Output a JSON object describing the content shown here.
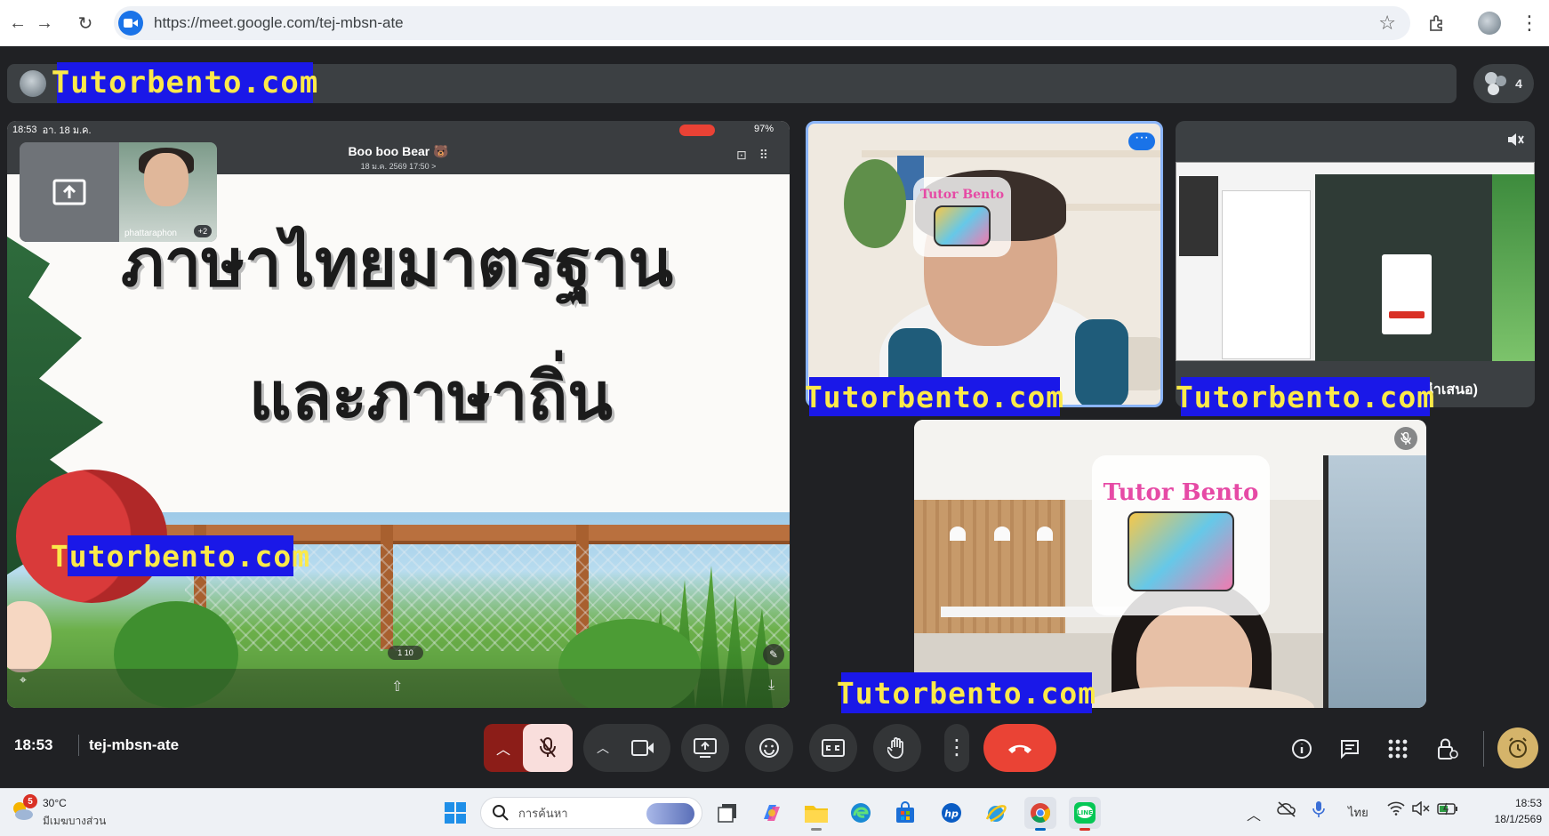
{
  "browser": {
    "url": "https://meet.google.com/tej-mbsn-ate",
    "back_glyph": "←",
    "forward_glyph": "→",
    "reload_glyph": "↻",
    "star_glyph": "☆",
    "menu_glyph": "⋮"
  },
  "watermark": "Tutorbento.com",
  "top_bar": {
    "people_count": "4"
  },
  "main_screen": {
    "status_time": "18:53",
    "status_date": "อา. 18 ม.ค.",
    "battery": "97%",
    "doc_title": "Boo boo Bear 🐻",
    "doc_subtitle": "18 ม.ค. 2569 17:50 >",
    "slide_line1": "ภาษาไทยมาตรฐาน",
    "slide_line2": "และภาษาถิ่น",
    "pager": "1 10",
    "pip_name": "phattaraphon",
    "pip_badge": "+2"
  },
  "tile1": {
    "logo_text": "Tutor Bento"
  },
  "tile2": {
    "name_suffix": "นนำเสนอ)"
  },
  "tile3": {
    "logo_text": "Tutor Bento"
  },
  "controls": {
    "time": "18:53",
    "meeting_code": "tej-mbsn-ate",
    "colors": {
      "mic_off_bg": "#f9dedc",
      "end_call": "#ea4335",
      "accent": "#8ab4f8",
      "watermark_bg": "#1a18e8",
      "watermark_fg": "#fbe94a"
    }
  },
  "taskbar": {
    "weather_badge": "5",
    "temperature": "30°C",
    "weather_desc": "มีเมฆบางส่วน",
    "search_placeholder": "การค้นหา",
    "language": "ไทย",
    "clock_time": "18:53",
    "clock_date": "18/1/2569"
  }
}
